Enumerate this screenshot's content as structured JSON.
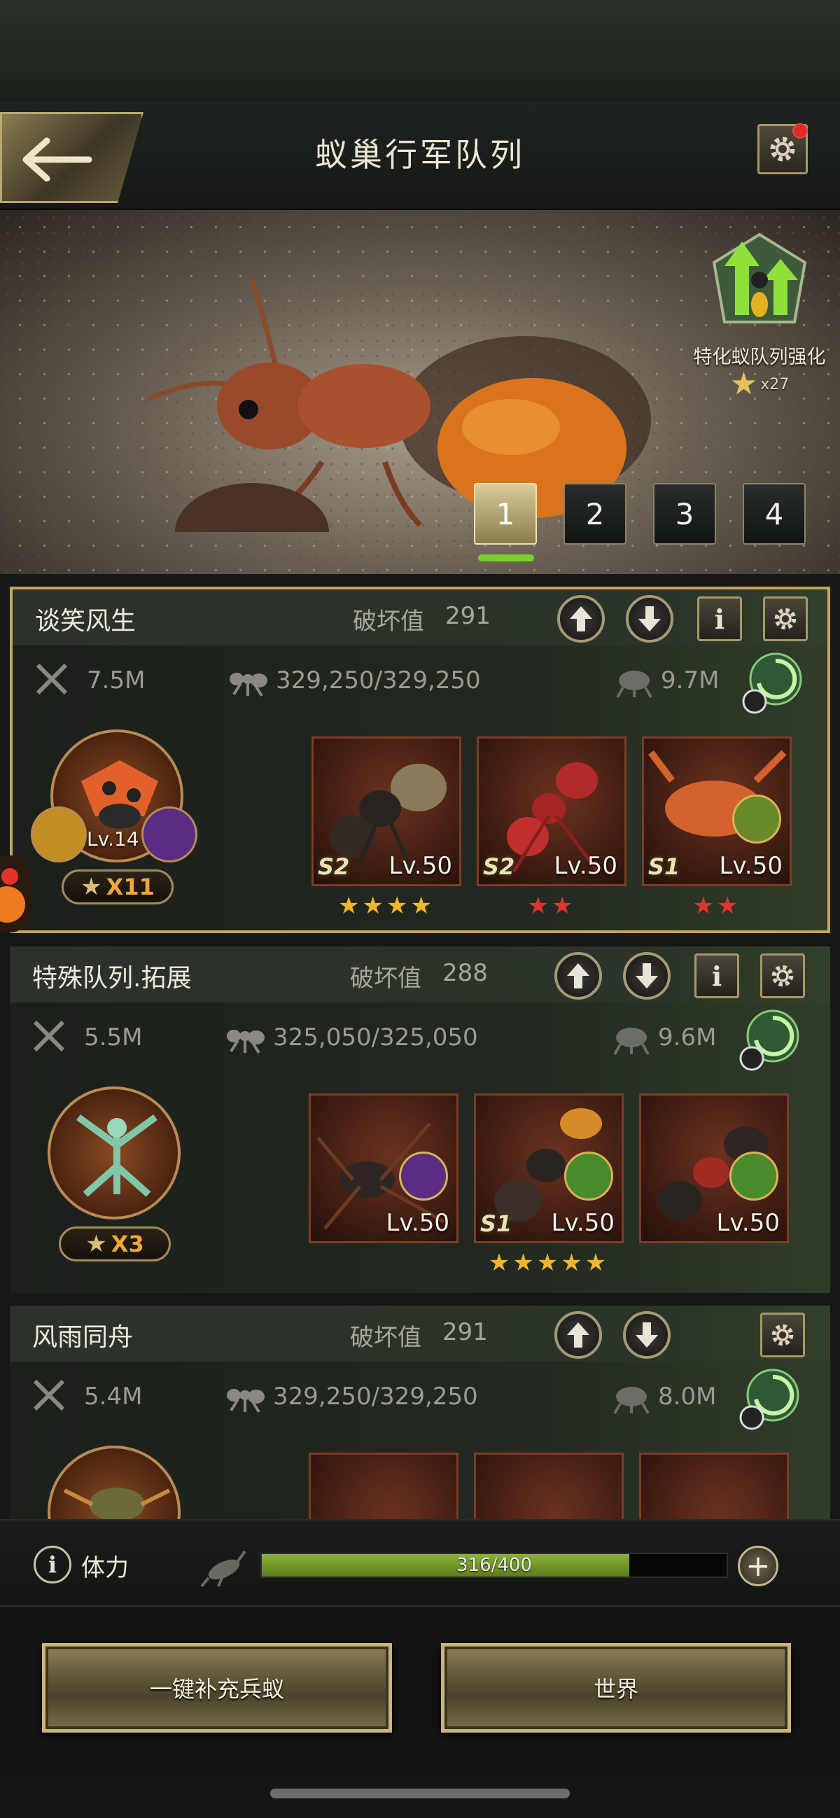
{
  "header": {
    "title": "蚁巢行军队列",
    "back_icon": "back-arrow-icon",
    "settings_icon": "gear-icon"
  },
  "banner": {
    "upgrade_label": "特化蚁队列强化",
    "upgrade_count": "x27",
    "tabs": [
      {
        "label": "1",
        "active": true
      },
      {
        "label": "2"
      },
      {
        "label": "3"
      },
      {
        "label": "4"
      }
    ]
  },
  "squads": [
    {
      "name": "谈笑风生",
      "damage_label": "破坏值",
      "damage_value": "291",
      "power": "7.5M",
      "troops": "329,250/329,250",
      "load": "9.7M",
      "commander": {
        "level": "Lv.14",
        "multiplier": "X11"
      },
      "units": [
        {
          "grade": "S2",
          "level": "Lv.50",
          "stars": "★★★★",
          "star_color": "gold"
        },
        {
          "grade": "S2",
          "level": "Lv.50",
          "stars": "★★",
          "star_color": "red"
        },
        {
          "grade": "S1",
          "level": "Lv.50",
          "stars": "★★",
          "star_color": "red"
        }
      ]
    },
    {
      "name": "特殊队列.拓展",
      "damage_label": "破坏值",
      "damage_value": "288",
      "power": "5.5M",
      "troops": "325,050/325,050",
      "load": "9.6M",
      "commander": {
        "level": "",
        "multiplier": "X3"
      },
      "units": [
        {
          "grade": "",
          "level": "Lv.50",
          "stars": "",
          "star_color": "gold"
        },
        {
          "grade": "S1",
          "level": "Lv.50",
          "stars": "★★★★★",
          "star_color": "gold"
        },
        {
          "grade": "",
          "level": "Lv.50",
          "stars": "",
          "star_color": "gold"
        }
      ]
    },
    {
      "name": "风雨同舟",
      "damage_label": "破坏值",
      "damage_value": "291",
      "power": "5.4M",
      "troops": "329,250/329,250",
      "load": "8.0M"
    }
  ],
  "stamina": {
    "label": "体力",
    "value": "316/400",
    "current": 316,
    "max": 400
  },
  "actions": {
    "refill": "一键补充兵蚁",
    "world": "世界"
  },
  "colors": {
    "accent_gold": "#c9b57c",
    "stamina_green": "#8cb23a",
    "selected_border": "#c6a459",
    "star_gold": "#f0b62f",
    "star_red": "#e03434"
  }
}
